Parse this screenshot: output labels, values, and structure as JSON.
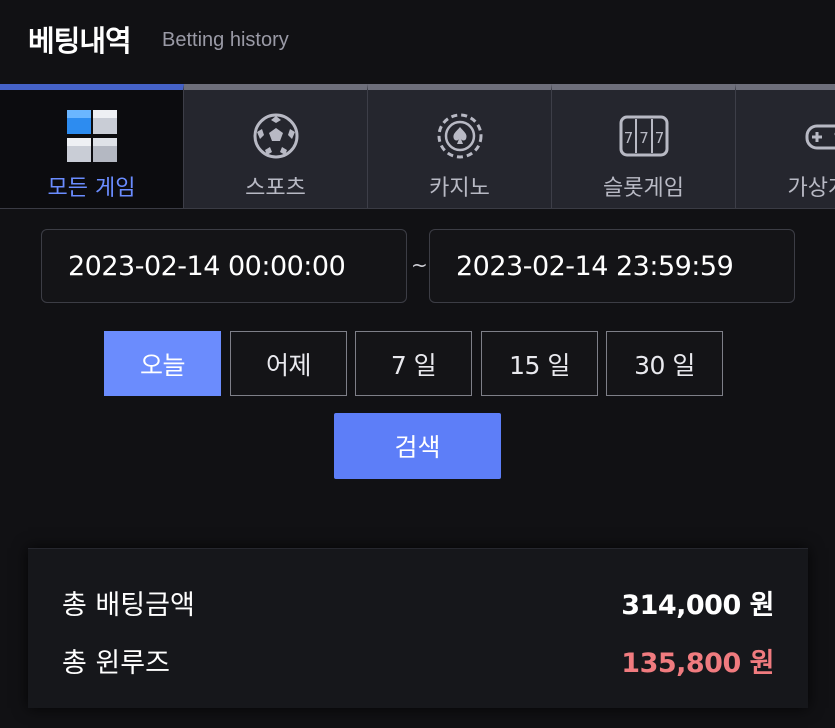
{
  "header": {
    "title": "베팅내역",
    "subtitle": "Betting history"
  },
  "tabs": [
    {
      "label": "모든 게임",
      "icon": "all-games-cube-icon",
      "active": true
    },
    {
      "label": "스포츠",
      "icon": "soccer-ball-icon",
      "active": false
    },
    {
      "label": "카지노",
      "icon": "casino-chip-icon",
      "active": false
    },
    {
      "label": "슬롯게임",
      "icon": "slot-machine-icon",
      "active": false
    },
    {
      "label": "가상게임",
      "icon": "virtual-game-icon",
      "active": false
    }
  ],
  "date_range": {
    "start": "2023-02-14 00:00:00",
    "separator": "~",
    "end": "2023-02-14 23:59:59"
  },
  "quick_ranges": [
    {
      "label": "오늘",
      "active": true
    },
    {
      "label": "어제",
      "active": false
    },
    {
      "label": "7 일",
      "active": false
    },
    {
      "label": "15 일",
      "active": false
    },
    {
      "label": "30 일",
      "active": false
    }
  ],
  "search_label": "검색",
  "summary": {
    "total_bet_label": "총 배팅금액",
    "total_bet_value": "314,000 원",
    "total_winloss_label": "총 윈루즈",
    "total_winloss_value": "135,800 원"
  },
  "colors": {
    "accent": "#5d7ef8",
    "active_tab_bar": "#4562c8",
    "negative_value": "#f07b7f"
  }
}
